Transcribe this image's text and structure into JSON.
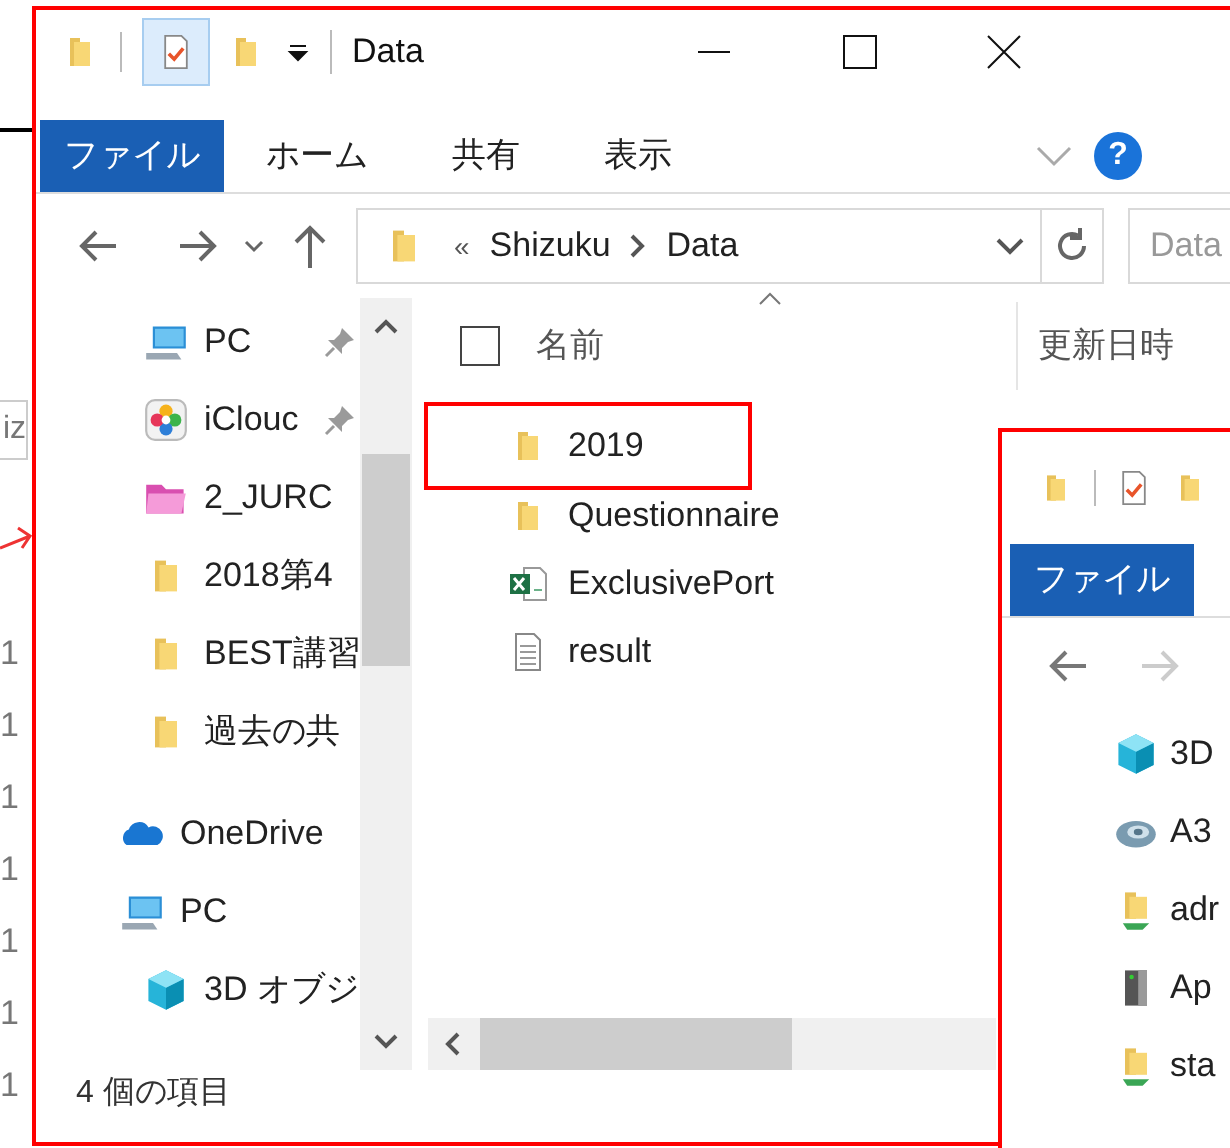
{
  "background_window": {
    "search_value": "iz",
    "rows": [
      "1",
      "1",
      "1",
      "1",
      "1",
      "1",
      "1"
    ]
  },
  "window": {
    "title": "Data"
  },
  "ribbon": {
    "tabs": [
      {
        "label": "ファイル",
        "selected": true
      },
      {
        "label": "ホーム",
        "selected": false
      },
      {
        "label": "共有",
        "selected": false
      },
      {
        "label": "表示",
        "selected": false
      }
    ],
    "help": "?"
  },
  "address_bar": {
    "overflow": "«",
    "segments": [
      "Shizuku",
      "Data"
    ],
    "search_placeholder": "Data"
  },
  "navigation": {
    "quick_access": [
      {
        "label": "PC",
        "kind": "pc",
        "pinned": true
      },
      {
        "label": "iClouc",
        "kind": "photos",
        "pinned": true
      },
      {
        "label": "2_JURC",
        "kind": "pink-folder",
        "pinned": false
      },
      {
        "label": "2018第4",
        "kind": "folder",
        "pinned": false
      },
      {
        "label": "BEST講習",
        "kind": "folder",
        "pinned": false
      },
      {
        "label": "過去の共",
        "kind": "folder",
        "pinned": false
      }
    ],
    "roots": [
      {
        "label": "OneDrive",
        "kind": "cloud"
      },
      {
        "label": "PC",
        "kind": "pc",
        "children": [
          {
            "label": "3D オブジ",
            "kind": "cube"
          }
        ]
      }
    ]
  },
  "select_all": {
    "checked": false
  },
  "columns": [
    {
      "label": "名前",
      "sorted": true
    },
    {
      "label": "更新日時",
      "sorted": false
    }
  ],
  "files": [
    {
      "name": "2019",
      "kind": "folder",
      "annotated": true
    },
    {
      "name": "Questionnaire",
      "kind": "folder",
      "annotated": false
    },
    {
      "name": "ExclusivePort",
      "kind": "excel",
      "annotated": false
    },
    {
      "name": "result",
      "kind": "text",
      "annotated": false
    }
  ],
  "status_bar": "4 個の項目",
  "second_window": {
    "tab": "ファイル",
    "nav_items": [
      {
        "label": "3D",
        "kind": "cube"
      },
      {
        "label": "A3",
        "kind": "swirl"
      },
      {
        "label": "adr",
        "kind": "share-folder"
      },
      {
        "label": "Ap",
        "kind": "drive"
      },
      {
        "label": "sta",
        "kind": "share-folder"
      }
    ]
  }
}
